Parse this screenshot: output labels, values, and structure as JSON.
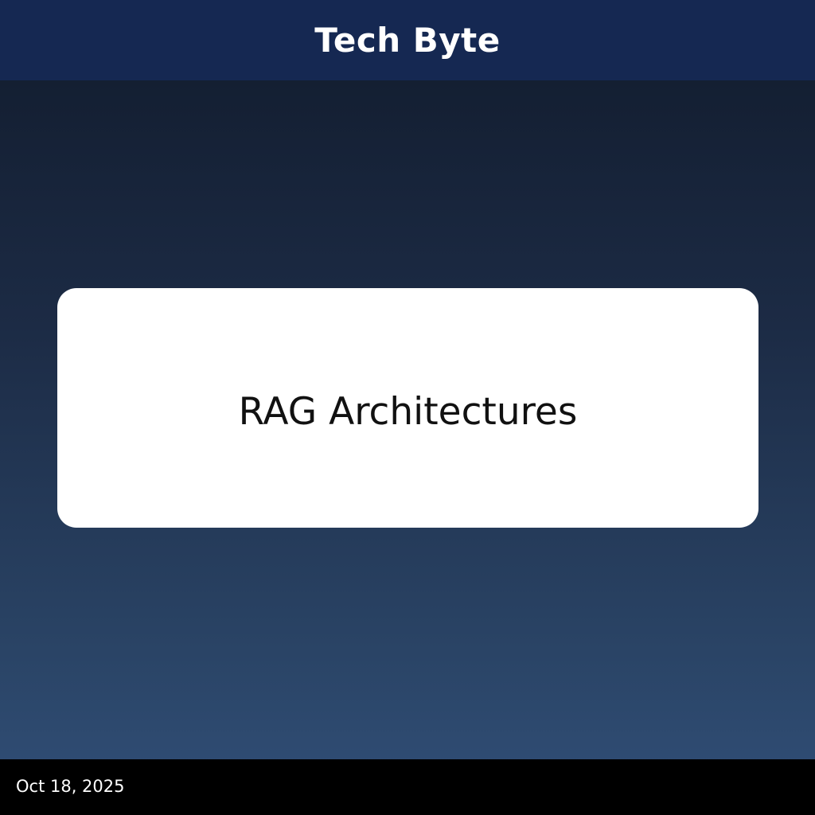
{
  "header": {
    "title": "Tech Byte"
  },
  "card": {
    "title": "RAG Architectures"
  },
  "footer": {
    "date": "Oct 18, 2025"
  },
  "colors": {
    "header_bg": "#152852",
    "gradient_top": "#111b2c",
    "gradient_bottom": "#314f78",
    "card_bg": "#ffffff",
    "footer_bg": "#000000"
  }
}
